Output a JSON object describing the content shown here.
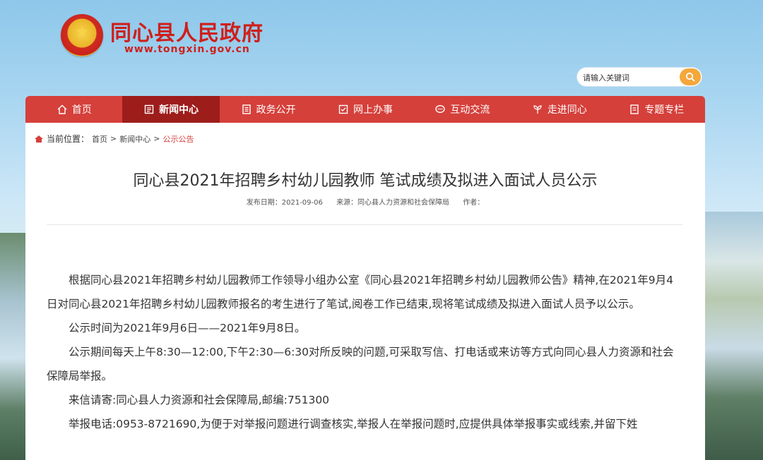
{
  "site": {
    "name": "同心县人民政府",
    "url": "www.tongxin.gov.cn"
  },
  "search": {
    "placeholder": "请输入关键词"
  },
  "nav": [
    {
      "label": "首页",
      "icon": "home-icon"
    },
    {
      "label": "新闻中心",
      "icon": "news-icon",
      "active": true
    },
    {
      "label": "政务公开",
      "icon": "document-icon"
    },
    {
      "label": "网上办事",
      "icon": "form-icon"
    },
    {
      "label": "互动交流",
      "icon": "chat-icon"
    },
    {
      "label": "走进同心",
      "icon": "leaf-icon"
    },
    {
      "label": "专题专栏",
      "icon": "list-icon"
    }
  ],
  "breadcrumb": {
    "label": "当前位置：",
    "items": [
      "首页",
      "新闻中心",
      "公示公告"
    ],
    "sep": ">"
  },
  "article": {
    "title": "同心县2021年招聘乡村幼儿园教师 笔试成绩及拟进入面试人员公示",
    "meta": {
      "date": "发布日期：2021-09-06",
      "source": "来源：同心县人力资源和社会保障局",
      "author": "作者："
    },
    "paragraphs": [
      "根据同心县2021年招聘乡村幼儿园教师工作领导小组办公室《同心县2021年招聘乡村幼儿园教师公告》精神,在2021年9月4日对同心县2021年招聘乡村幼儿园教师报名的考生进行了笔试,阅卷工作已结束,现将笔试成绩及拟进入面试人员予以公示。",
      "公示时间为2021年9月6日——2021年9月8日。",
      "公示期间每天上午8:30—12:00,下午2:30—6:30对所反映的问题,可采取写信、打电话或来访等方式向同心县人力资源和社会保障局举报。",
      "来信请寄:同心县人力资源和社会保障局,邮编:751300",
      "举报电话:0953-8721690,为便于对举报问题进行调查核实,举报人在举报问题时,应提供具体举报事实或线索,并留下姓"
    ]
  },
  "colors": {
    "brand_red": "#d5403b",
    "active_red": "#9d1d1b",
    "search_button": "#f4a73a"
  }
}
